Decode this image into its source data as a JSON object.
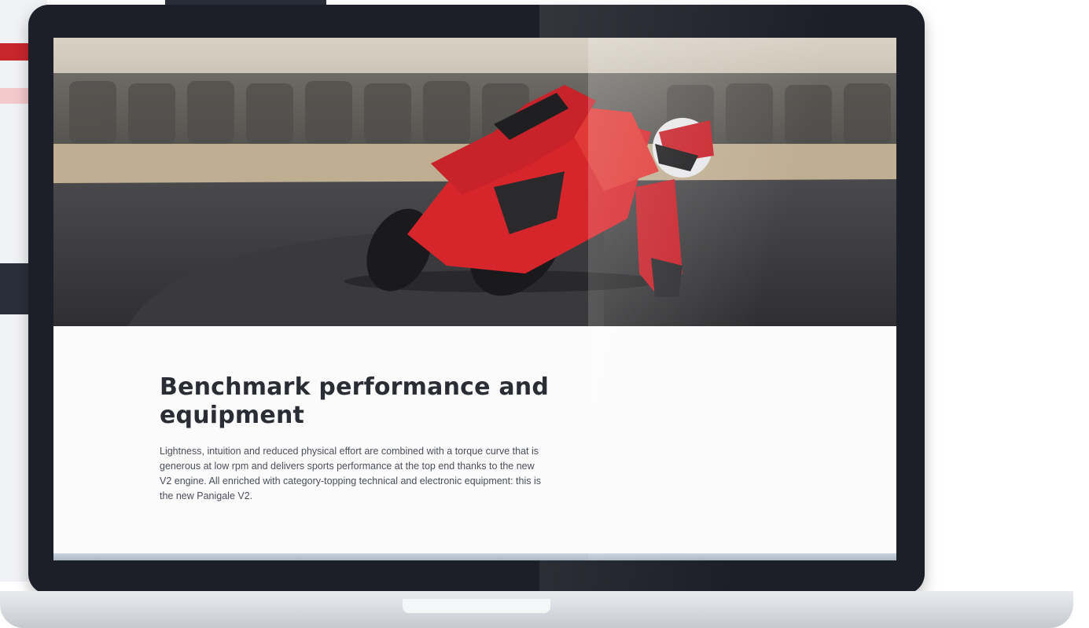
{
  "page": {
    "heading": "Benchmark performance and equipment",
    "body": "Lightness, intuition and reduced physical effort are combined with a torque curve that is generous at low rpm and delivers sports performance at the top end thanks to the new V2 engine. All enriched with category-topping technical and electronic equipment: this is the new Panigale V2."
  },
  "hero": {
    "image": "motorcycle-racing-photo"
  },
  "colors": {
    "bike_red": "#d7262b",
    "laptop_frame": "#1c1f27",
    "heading_text": "#2a2d33"
  }
}
